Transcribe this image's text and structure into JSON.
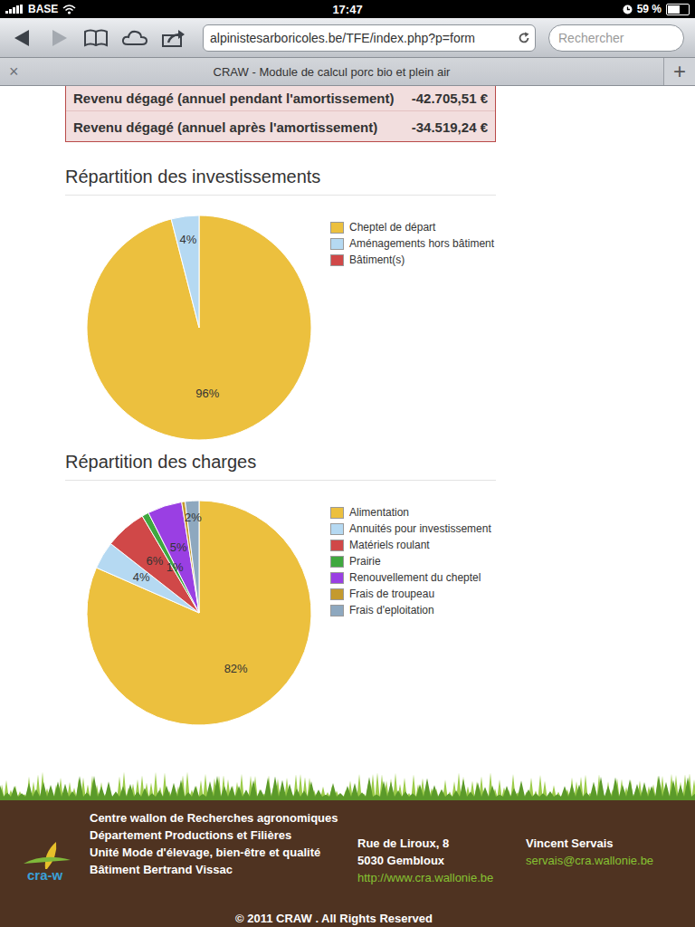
{
  "status_bar": {
    "carrier": "BASE",
    "time": "17:47",
    "battery": "59 %",
    "battery_level": 0.59
  },
  "browser": {
    "url": "alpinistesarboricoles.be/TFE/index.php?p=form",
    "search_placeholder": "Rechercher",
    "back_enabled": true,
    "forward_enabled": false
  },
  "tabs": [
    {
      "label": "CRAW - Module de calcul porc bio et plein air",
      "selected": true,
      "close": "×"
    }
  ],
  "new_tab": "+",
  "results": [
    {
      "label": "Revenu dégagé (annuel pendant l'amortissement)",
      "value": "-42.705,51 €"
    },
    {
      "label": "Revenu dégagé (annuel après l'amortissement)",
      "value": "-34.519,24 €"
    }
  ],
  "charts": [
    {
      "title": "Répartition des investissements",
      "slices": [
        {
          "legend": "Cheptel de départ",
          "value": 96,
          "label": "96%",
          "color": "#ecc03e"
        },
        {
          "legend": "Aménagements hors bâtiment",
          "value": 4,
          "label": "4%",
          "color": "#b5d9f2"
        },
        {
          "legend": "Bâtiment(s)",
          "value": 0,
          "label": "",
          "color": "#d04848"
        }
      ]
    },
    {
      "title": "Répartition des charges",
      "slices": [
        {
          "legend": "Alimentation",
          "value": 82,
          "label": "82%",
          "color": "#ecc03e"
        },
        {
          "legend": "Annuités pour investissement",
          "value": 4,
          "label": "4%",
          "color": "#b5d9f2"
        },
        {
          "legend": "Matériels roulant",
          "value": 6,
          "label": "6%",
          "color": "#d04848"
        },
        {
          "legend": "Prairie",
          "value": 1,
          "label": "1%",
          "color": "#3fa83f"
        },
        {
          "legend": "Renouvellement du cheptel",
          "value": 5,
          "label": "5%",
          "color": "#9a3fe3"
        },
        {
          "legend": "Frais de troupeau",
          "value": 0.5,
          "label": "",
          "color": "#c49a2e"
        },
        {
          "legend": "Frais d'eploitation",
          "value": 2,
          "label": "2%",
          "color": "#8ea8bf"
        }
      ]
    }
  ],
  "footer": {
    "logo_text": "cra-w",
    "org_lines": [
      "Centre wallon de Recherches agronomiques Département Productions et Filières",
      "Unité Mode d'élevage, bien-être et qualité",
      "Bâtiment Bertrand Vissac"
    ],
    "address_lines": [
      "Rue de Liroux, 8",
      "5030 Gembloux"
    ],
    "website": "http://www.cra.wallonie.be",
    "contact_name": "Vincent Servais",
    "contact_email": "servais@cra.wallonie.be",
    "copyright": "© 2011 CRAW . All Rights Reserved"
  }
}
